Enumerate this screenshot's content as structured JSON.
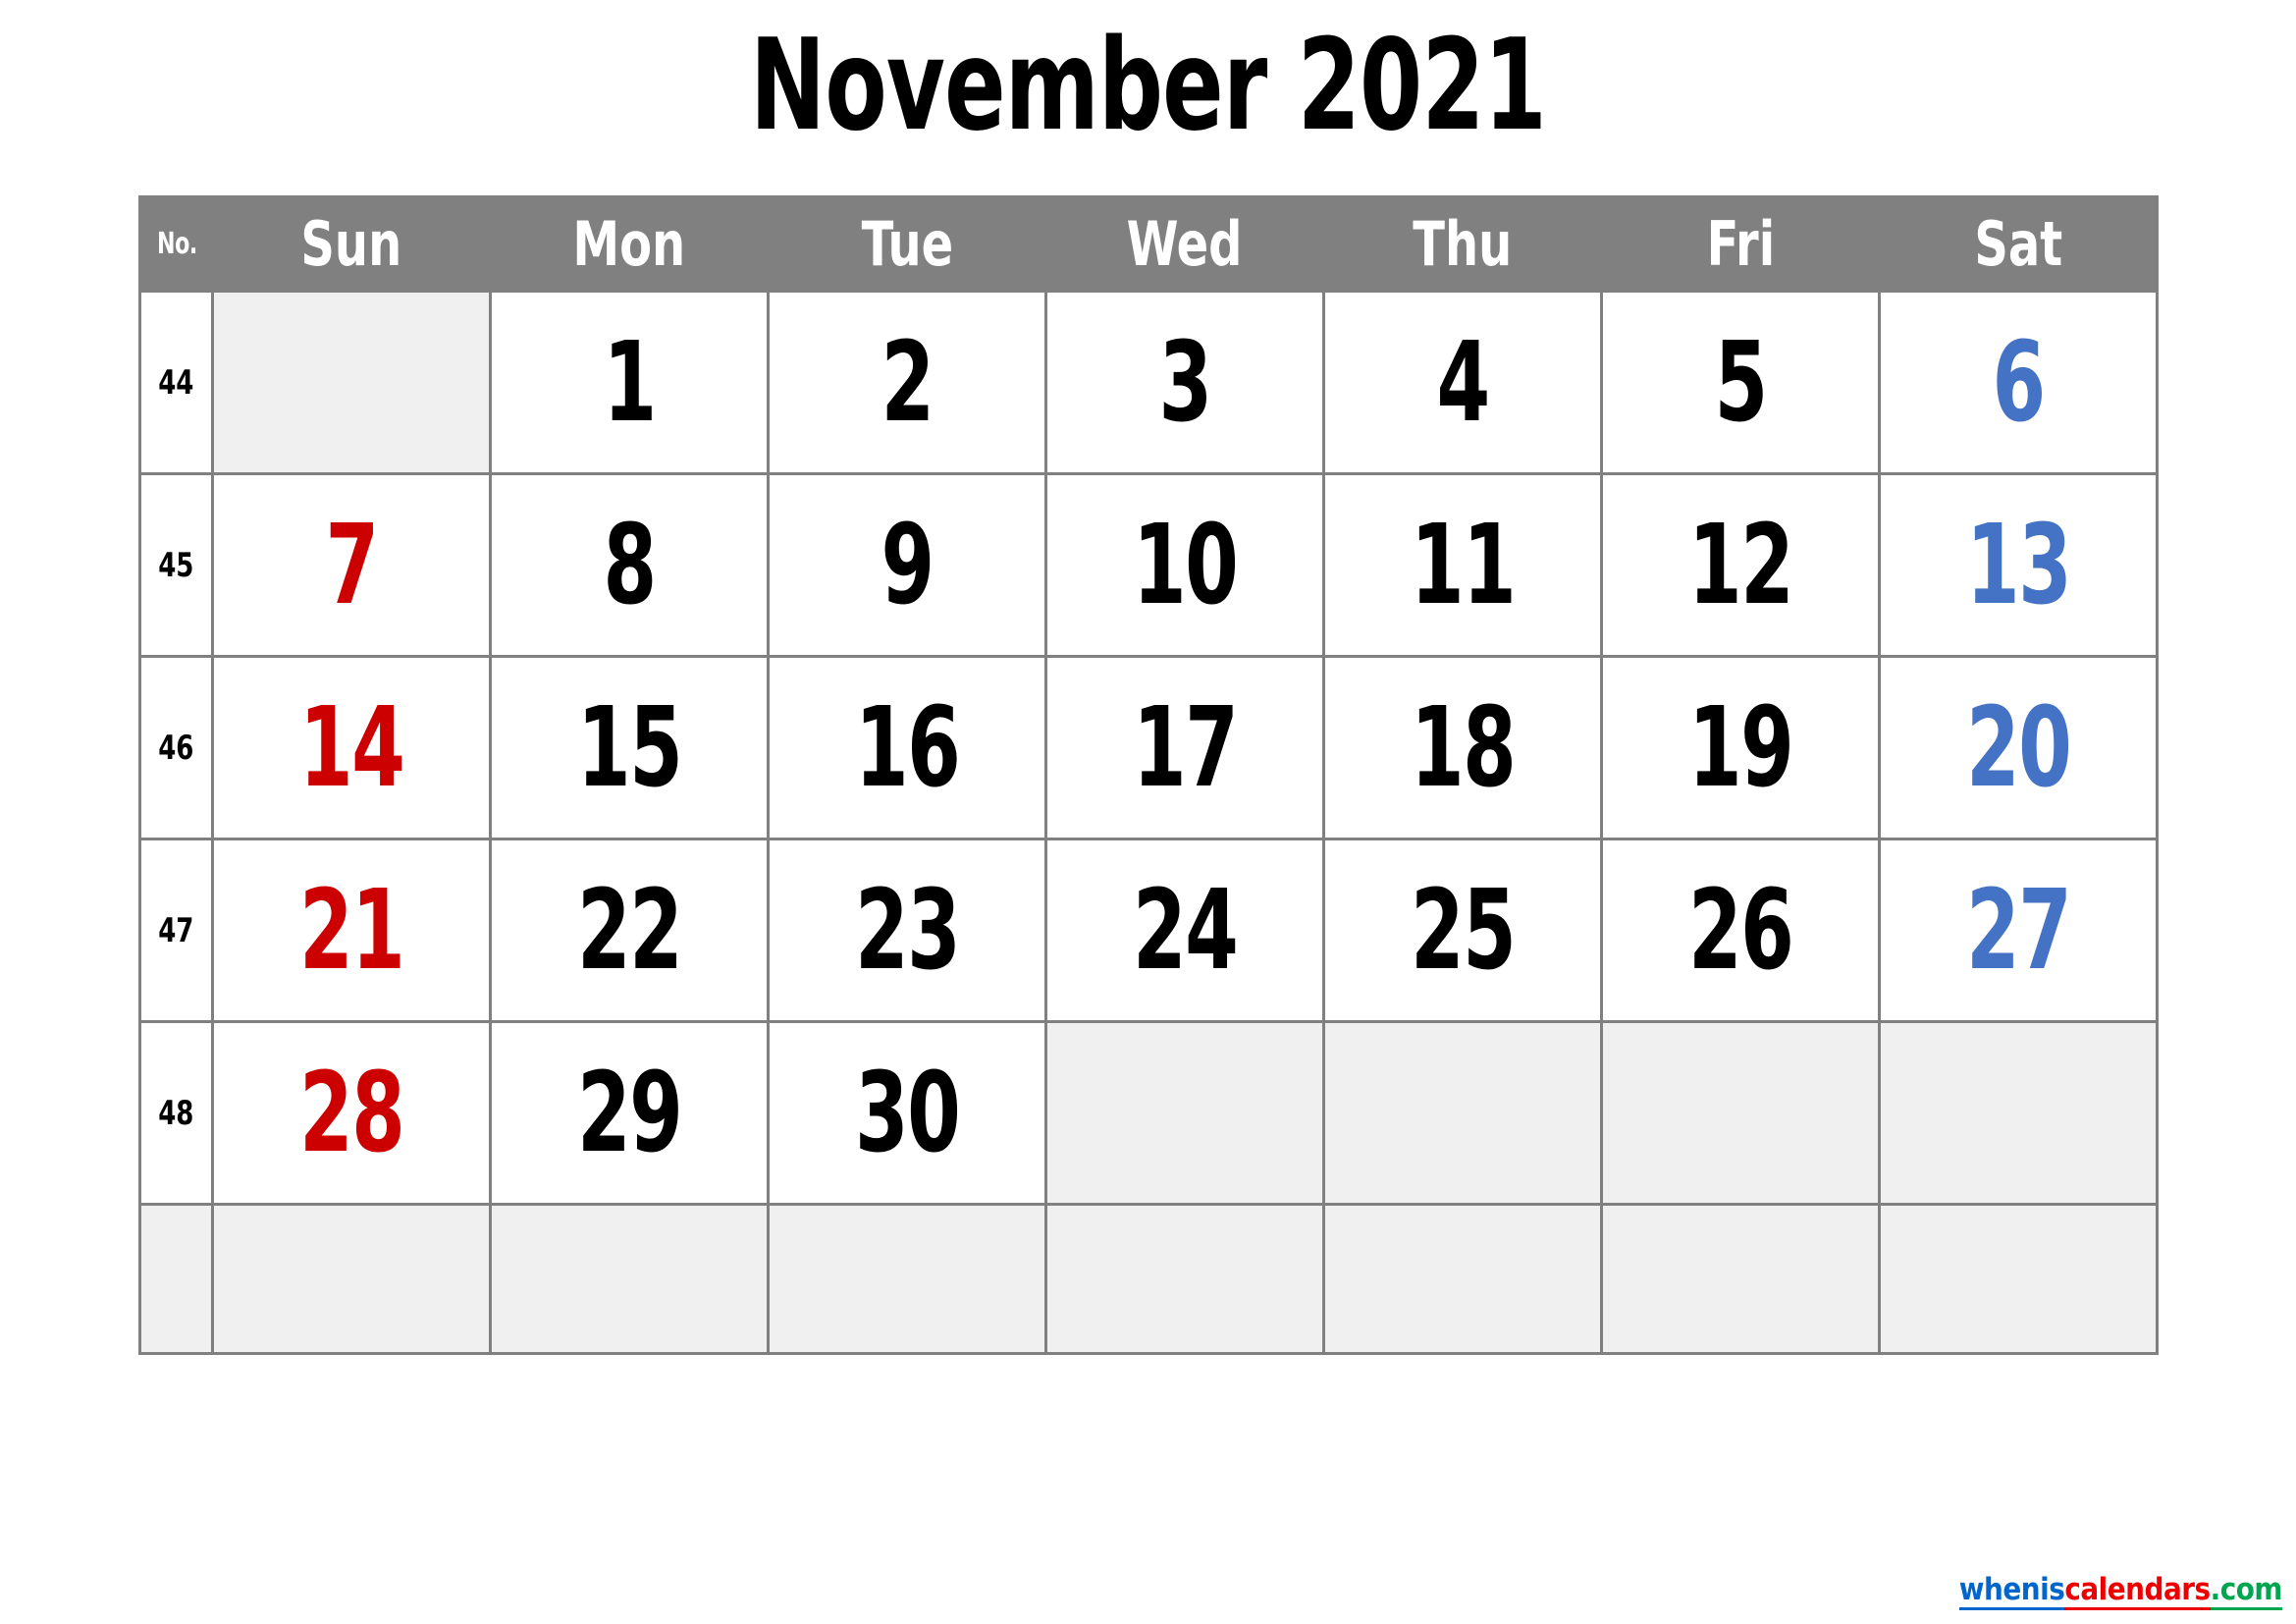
{
  "title": "November 2021",
  "colors": {
    "header_bg": "#808080",
    "header_text": "#ffffff",
    "grid_border": "#808080",
    "blank_cell": "#f0f0f0",
    "sunday": "#CC0000",
    "saturday": "#4472C4",
    "weekday": "#000000",
    "watermark_blue": "#0066CC",
    "watermark_red": "#EE0000",
    "watermark_green": "#00A550"
  },
  "header": {
    "week_no_label": "No.",
    "days": [
      "Sun",
      "Mon",
      "Tue",
      "Wed",
      "Thu",
      "Fri",
      "Sat"
    ]
  },
  "weeks": [
    {
      "no": "44",
      "days": [
        {
          "value": "",
          "kind": "blank"
        },
        {
          "value": "1",
          "kind": "weekday"
        },
        {
          "value": "2",
          "kind": "weekday"
        },
        {
          "value": "3",
          "kind": "weekday"
        },
        {
          "value": "4",
          "kind": "weekday"
        },
        {
          "value": "5",
          "kind": "weekday"
        },
        {
          "value": "6",
          "kind": "sat"
        }
      ]
    },
    {
      "no": "45",
      "days": [
        {
          "value": "7",
          "kind": "sun"
        },
        {
          "value": "8",
          "kind": "weekday"
        },
        {
          "value": "9",
          "kind": "weekday"
        },
        {
          "value": "10",
          "kind": "weekday"
        },
        {
          "value": "11",
          "kind": "weekday"
        },
        {
          "value": "12",
          "kind": "weekday"
        },
        {
          "value": "13",
          "kind": "sat"
        }
      ]
    },
    {
      "no": "46",
      "days": [
        {
          "value": "14",
          "kind": "sun"
        },
        {
          "value": "15",
          "kind": "weekday"
        },
        {
          "value": "16",
          "kind": "weekday"
        },
        {
          "value": "17",
          "kind": "weekday"
        },
        {
          "value": "18",
          "kind": "weekday"
        },
        {
          "value": "19",
          "kind": "weekday"
        },
        {
          "value": "20",
          "kind": "sat"
        }
      ]
    },
    {
      "no": "47",
      "days": [
        {
          "value": "21",
          "kind": "sun"
        },
        {
          "value": "22",
          "kind": "weekday"
        },
        {
          "value": "23",
          "kind": "weekday"
        },
        {
          "value": "24",
          "kind": "weekday"
        },
        {
          "value": "25",
          "kind": "weekday"
        },
        {
          "value": "26",
          "kind": "weekday"
        },
        {
          "value": "27",
          "kind": "sat"
        }
      ]
    },
    {
      "no": "48",
      "days": [
        {
          "value": "28",
          "kind": "sun"
        },
        {
          "value": "29",
          "kind": "weekday"
        },
        {
          "value": "30",
          "kind": "weekday"
        },
        {
          "value": "",
          "kind": "blank"
        },
        {
          "value": "",
          "kind": "blank"
        },
        {
          "value": "",
          "kind": "blank"
        },
        {
          "value": "",
          "kind": "blank"
        }
      ]
    }
  ],
  "filler_row": {
    "no": "",
    "days": [
      "",
      "",
      "",
      "",
      "",
      "",
      ""
    ]
  },
  "watermark": {
    "part1": "whenis",
    "part2": "calendars",
    "part3": ".com"
  }
}
